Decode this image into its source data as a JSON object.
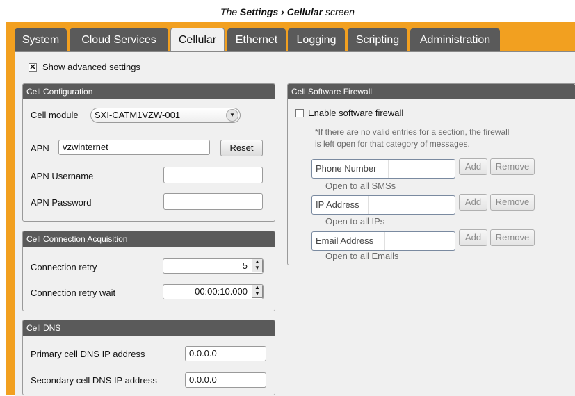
{
  "caption": {
    "prefix": "The ",
    "settings": "Settings",
    "sep": " › ",
    "cellular": "Cellular",
    "suffix": " screen"
  },
  "tabs": [
    "System",
    "Cloud Services",
    "Cellular",
    "Ethernet",
    "Logging",
    "Scripting",
    "Administration"
  ],
  "active_tab": "Cellular",
  "show_advanced": {
    "label": "Show advanced settings",
    "checked": true
  },
  "cell_config": {
    "title": "Cell Configuration",
    "module_label": "Cell module",
    "module_value": "SXI-CATM1VZW-001",
    "apn_label": "APN",
    "apn_value": "vzwinternet",
    "reset_label": "Reset",
    "user_label": "APN Username",
    "user_value": "",
    "pass_label": "APN Password",
    "pass_value": ""
  },
  "acquisition": {
    "title": "Cell Connection Acquisition",
    "retry_label": "Connection retry",
    "retry_value": "5",
    "wait_label": "Connection retry wait",
    "wait_value": "00:00:10.000"
  },
  "dns": {
    "title": "Cell DNS",
    "primary_label": "Primary cell DNS IP address",
    "primary_value": "0.0.0.0",
    "secondary_label": "Secondary cell DNS IP address",
    "secondary_value": "0.0.0.0"
  },
  "firewall": {
    "title": "Cell Software Firewall",
    "enable_label": "Enable software firewall",
    "enabled": false,
    "hint1": "*If there are no valid entries for a section, the firewall",
    "hint2": "is left open for that category of messages.",
    "add_label": "Add",
    "remove_label": "Remove",
    "rows": [
      {
        "placeholder": "Phone Number",
        "status": "Open to all SMSs"
      },
      {
        "placeholder": "IP Address",
        "status": "Open to all IPs"
      },
      {
        "placeholder": "Email Address",
        "status": "Open to all Emails"
      }
    ]
  },
  "colors": {
    "frame": "#f2a020",
    "header": "#5a5a5a",
    "panel": "#f0f0f0"
  },
  "icons": {
    "checked": "check-mark",
    "dropdown": "chevron-down-icon",
    "spinner": "up-down-arrows"
  }
}
